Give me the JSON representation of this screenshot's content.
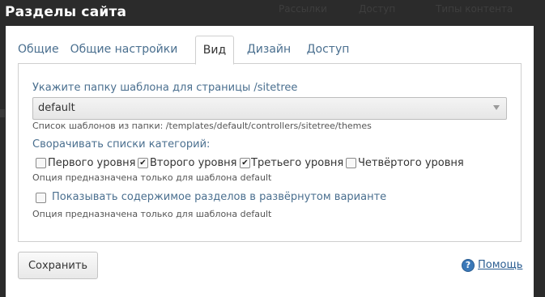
{
  "window": {
    "title": "Разделы сайта",
    "background_nav": [
      "Рассылки",
      "Доступ",
      "Типы контента"
    ]
  },
  "tabs": [
    {
      "label": "Общие",
      "active": false
    },
    {
      "label": "Общие настройки",
      "active": false
    },
    {
      "label": "Вид",
      "active": true
    },
    {
      "label": "Дизайн",
      "active": false
    },
    {
      "label": "Доступ",
      "active": false
    }
  ],
  "form": {
    "template_label": "Укажите папку шаблона для страницы /sitetree",
    "template_value": "default",
    "template_hint": "Список шаблонов из папки: /templates/default/controllers/sitetree/themes",
    "collapse_label": "Сворачивать списки категорий:",
    "levels": [
      {
        "label": "Первого уровня",
        "checked": false
      },
      {
        "label": "Второго уровня",
        "checked": true
      },
      {
        "label": "Третьего уровня",
        "checked": true
      },
      {
        "label": "Четвёртого уровня",
        "checked": false
      }
    ],
    "levels_hint": "Опция предназначена только для шаблона default",
    "expanded_label": "Показывать содержимое разделов в развёрнутом варианте",
    "expanded_checked": false,
    "expanded_hint": "Опция предназначена только для шаблона default"
  },
  "footer": {
    "save_label": "Сохранить",
    "help_label": "Помощь",
    "help_icon": "?"
  },
  "colors": {
    "link_blue": "#4a6f8f",
    "help_blue": "#2b5d91",
    "backdrop": "#2b2b2b"
  }
}
